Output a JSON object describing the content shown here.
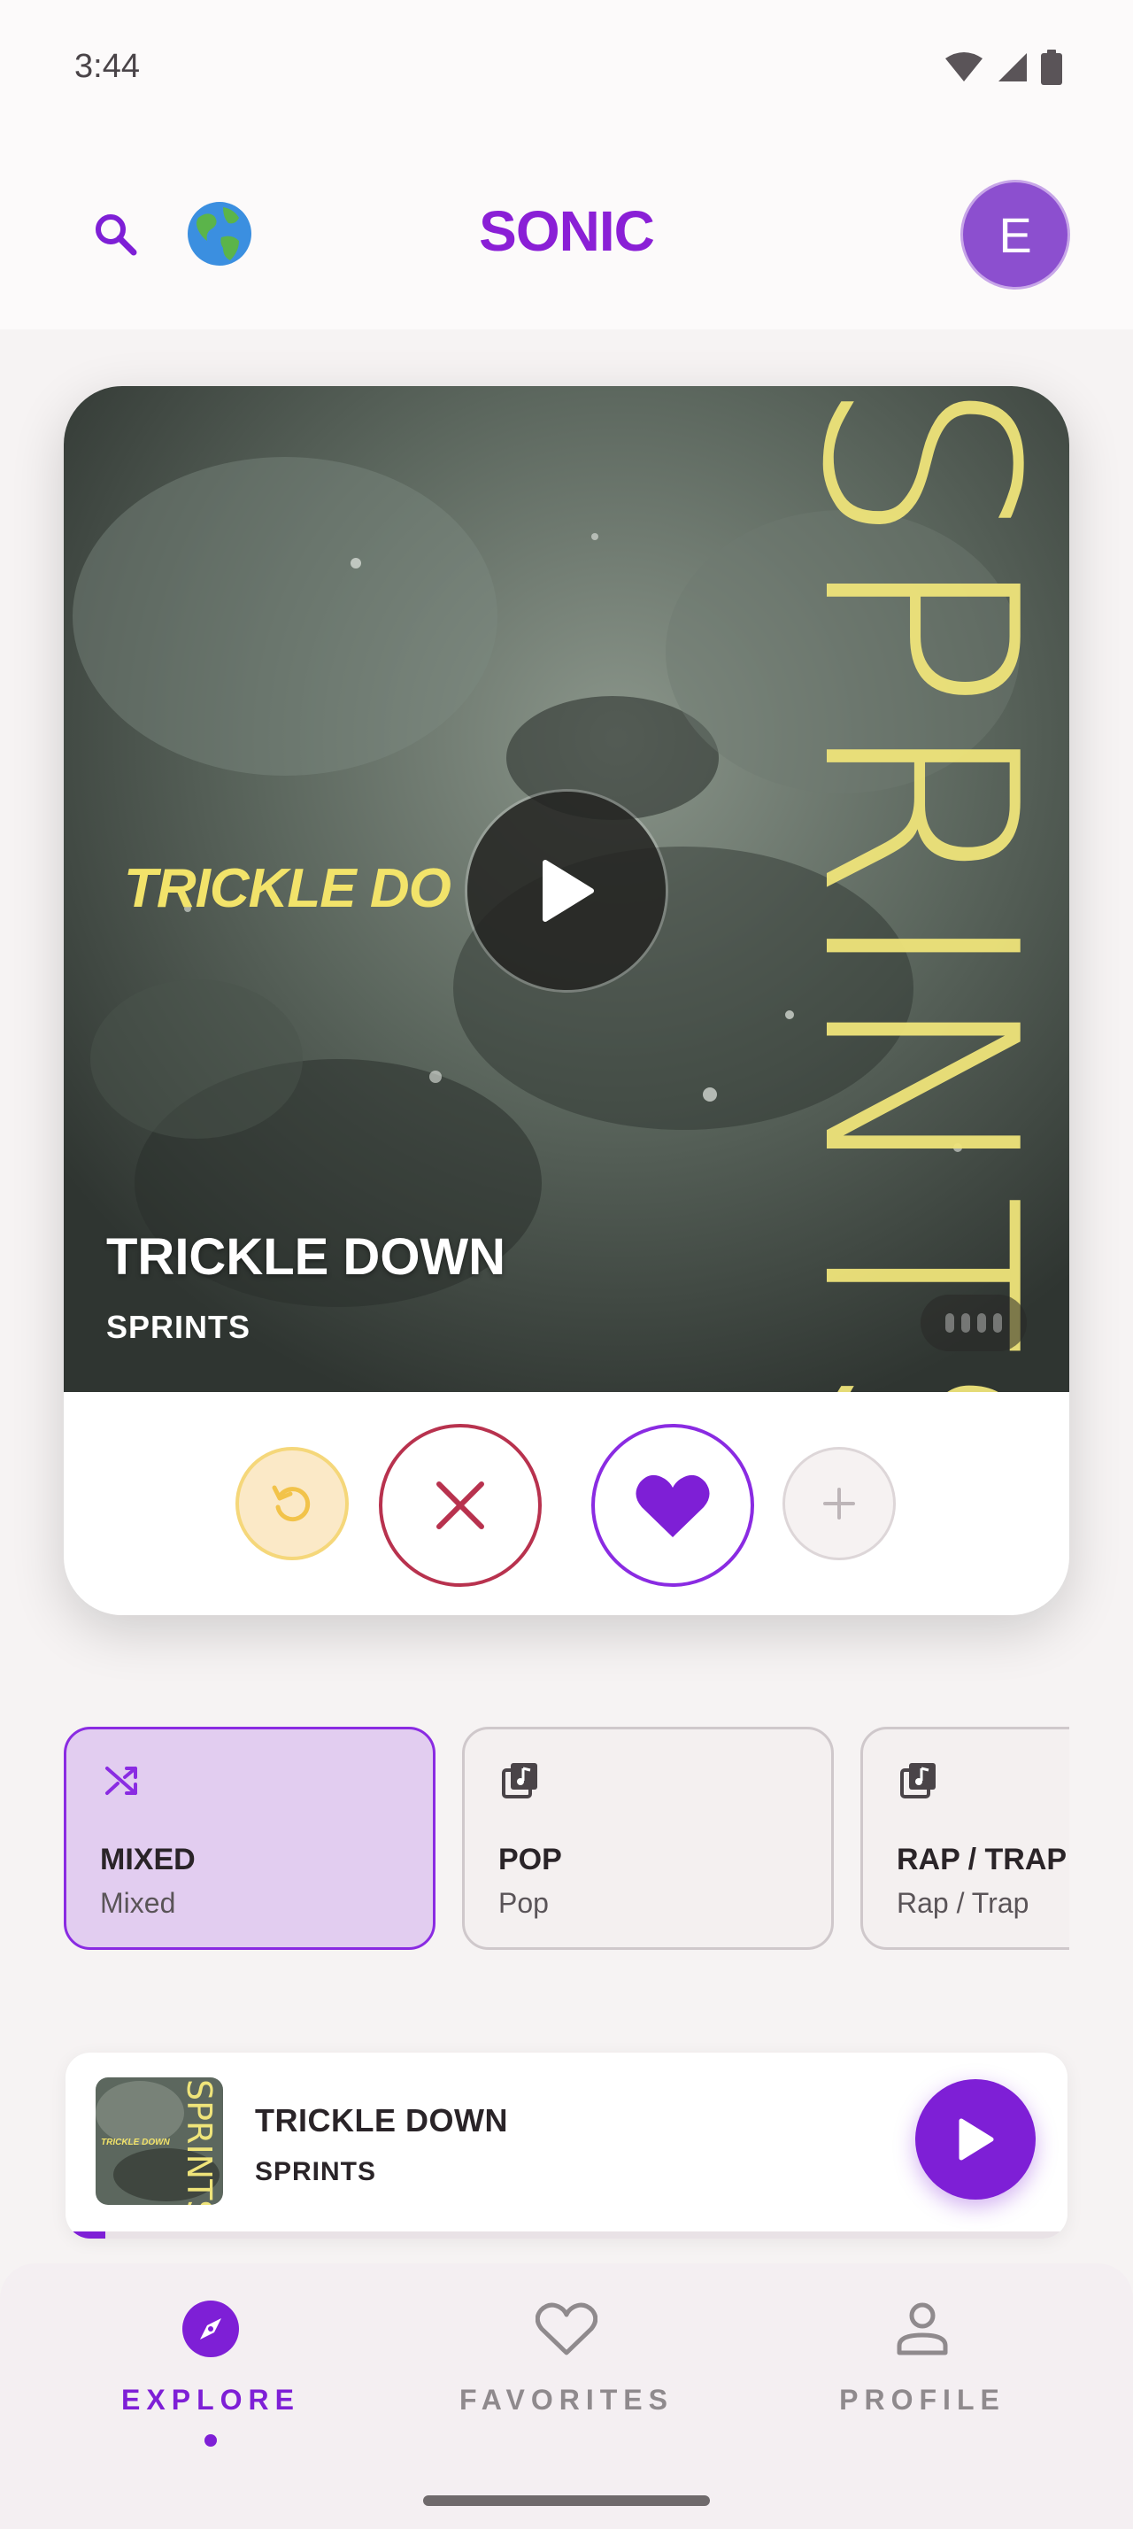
{
  "status_bar": {
    "time": "3:44"
  },
  "app_bar": {
    "title": "SONIC",
    "avatar_initial": "E",
    "globe_icon": "🌍"
  },
  "colors": {
    "brand": "#8a1fd6",
    "accent_yellow": "#f2e36a",
    "skip_red": "#b8324e"
  },
  "card": {
    "art_small_title": "TRICKLE DO",
    "art_big_text": "SPRINTS",
    "track_title": "TRICKLE DOWN",
    "artist": "SPRINTS"
  },
  "genres": [
    {
      "name": "MIXED",
      "sub": "Mixed",
      "icon": "shuffle-icon",
      "active": true
    },
    {
      "name": "POP",
      "sub": "Pop",
      "icon": "music-library-icon",
      "active": false
    },
    {
      "name": "RAP / TRAP",
      "sub": "Rap / Trap",
      "icon": "music-library-icon",
      "active": false
    }
  ],
  "now_playing": {
    "title": "TRICKLE DOWN",
    "artist": "SPRINTS",
    "thumb_small_text": "TRICKLE DOWN",
    "thumb_big_text": "SPRINTS",
    "progress": 0.04
  },
  "nav": [
    {
      "label": "EXPLORE",
      "icon": "compass-icon",
      "active": true
    },
    {
      "label": "FAVORITES",
      "icon": "heart-outline-icon",
      "active": false
    },
    {
      "label": "PROFILE",
      "icon": "person-icon",
      "active": false
    }
  ]
}
